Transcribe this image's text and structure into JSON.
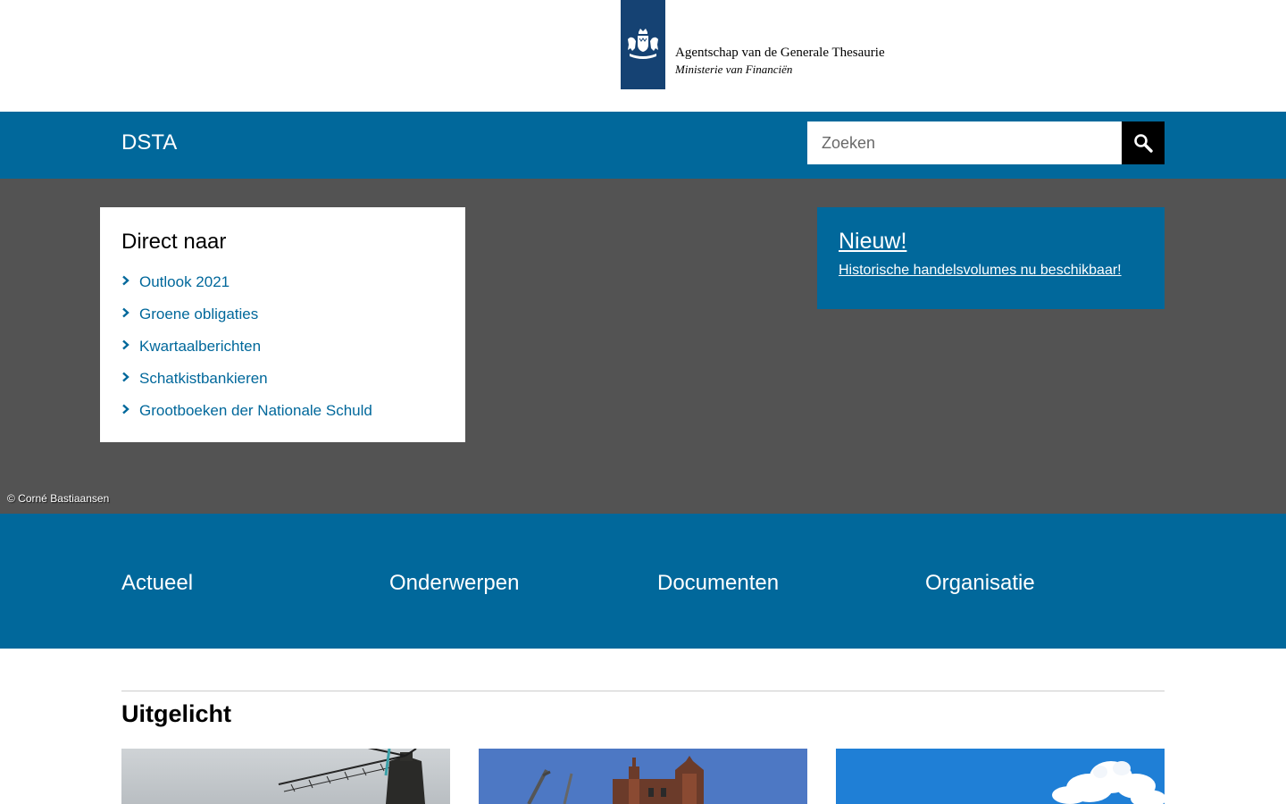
{
  "header": {
    "logo_icon": "coat-of-arms-icon",
    "logo_line1": "Agentschap van de Generale Thesaurie",
    "logo_line2": "Ministerie van Financiën",
    "brand_color": "#154273"
  },
  "topbar": {
    "site_name": "DSTA",
    "search_placeholder": "Zoeken",
    "search_value": "",
    "search_icon": "search-icon",
    "bar_color": "#01689b"
  },
  "hero": {
    "background_color": "#535353",
    "direct": {
      "title": "Direct naar",
      "items": [
        {
          "label": "Outlook 2021"
        },
        {
          "label": "Groene obligaties"
        },
        {
          "label": "Kwartaalberichten"
        },
        {
          "label": "Schatkistbankieren"
        },
        {
          "label": "Grootboeken der Nationale Schuld"
        }
      ]
    },
    "news": {
      "title": "Nieuw!",
      "link": "Historische handelsvolumes nu beschikbaar!"
    },
    "photo_credit": "© Corné Bastiaansen"
  },
  "main_nav": {
    "items": [
      {
        "label": "Actueel"
      },
      {
        "label": "Onderwerpen"
      },
      {
        "label": "Documenten"
      },
      {
        "label": "Organisatie"
      }
    ]
  },
  "featured": {
    "title": "Uitgelicht",
    "cards": [
      {
        "image": "windmill-photo"
      },
      {
        "image": "historic-building-photo"
      },
      {
        "image": "sky-clouds-photo"
      }
    ]
  }
}
